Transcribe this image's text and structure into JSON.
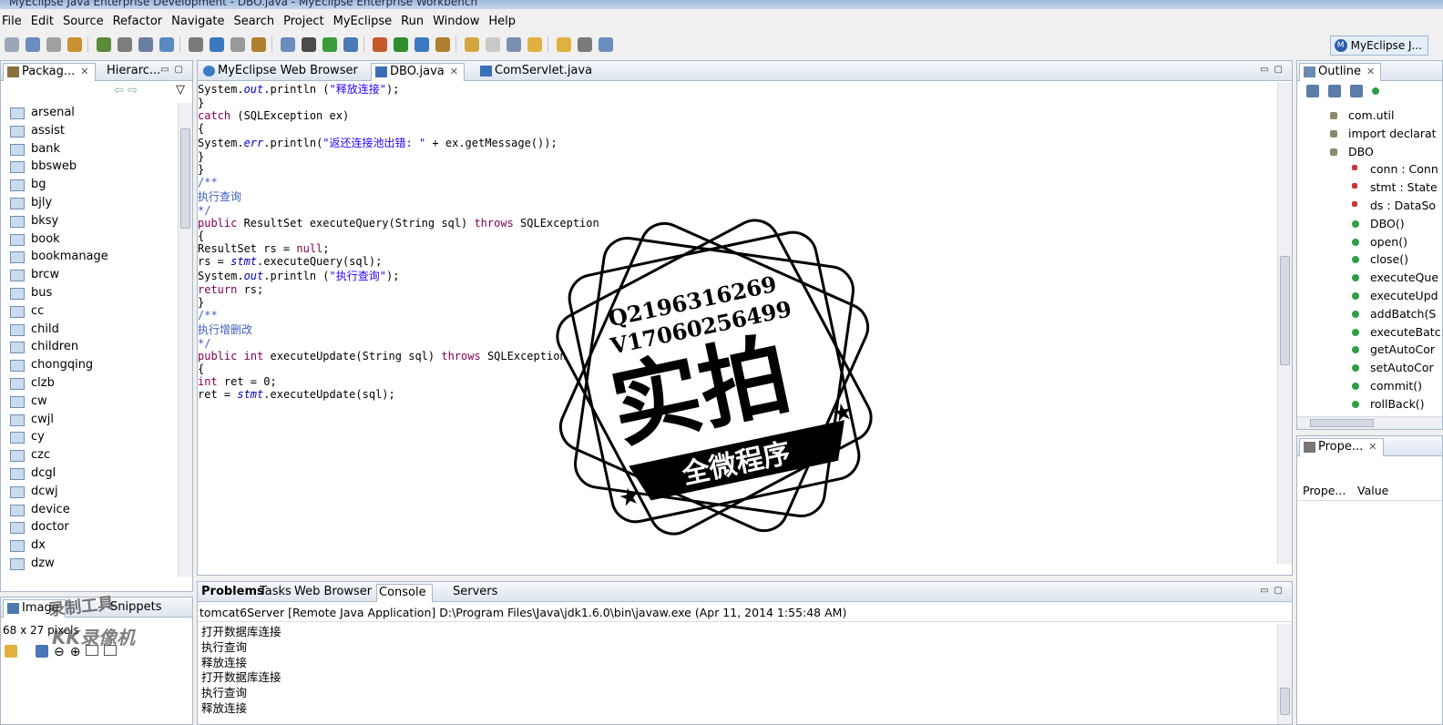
{
  "window": {
    "title": "MyEclipse Java Enterprise Development - DBO.java - MyEclipse Enterprise Workbench"
  },
  "menu": [
    "File",
    "Edit",
    "Source",
    "Refactor",
    "Navigate",
    "Search",
    "Project",
    "MyEclipse",
    "Run",
    "Window",
    "Help"
  ],
  "perspective": {
    "label": "MyEclipse J...",
    "icon": "myeclipse-icon"
  },
  "left_panel": {
    "tabs": [
      {
        "label": "Packag...",
        "icon": "package-icon"
      },
      {
        "label": "Hierarc...",
        "icon": "hierarchy-icon"
      }
    ],
    "items": [
      "arsenal",
      "assist",
      "bank",
      "bbsweb",
      "bg",
      "bjly",
      "bksy",
      "book",
      "bookmanage",
      "brcw",
      "bus",
      "cc",
      "child",
      "children",
      "chongqing",
      "clzb",
      "cw",
      "cwjl",
      "cy",
      "czc",
      "dcgl",
      "dcwj",
      "device",
      "doctor",
      "dx",
      "dzw"
    ]
  },
  "image_panel": {
    "tabs": [
      {
        "label": "Image",
        "icon": "image-icon"
      },
      {
        "label": "Snippets",
        "icon": "snippets-icon"
      }
    ],
    "size_text": "68 x 27 pixels",
    "watermark_top": "录制工具",
    "watermark_bottom": "KK录像机"
  },
  "editor": {
    "tabs": [
      {
        "label": "MyEclipse Web Browser",
        "icon": "globe-icon"
      },
      {
        "label": "DBO.java",
        "icon": "java-file-icon",
        "active": true
      },
      {
        "label": "ComServlet.java",
        "icon": "java-file-icon"
      }
    ],
    "lines": [
      {
        "indent": 8,
        "parts": [
          [
            "t",
            "System."
          ],
          [
            "f",
            "out"
          ],
          [
            "t",
            ".println ("
          ],
          [
            "s",
            "\"释放连接\""
          ],
          [
            "t",
            ");"
          ]
        ]
      },
      {
        "indent": 6,
        "parts": [
          [
            "t",
            "}"
          ]
        ]
      },
      {
        "indent": 6,
        "parts": [
          [
            "k",
            "catch"
          ],
          [
            "t",
            " (SQLException ex)"
          ]
        ]
      },
      {
        "indent": 6,
        "parts": [
          [
            "t",
            "{"
          ]
        ]
      },
      {
        "indent": 8,
        "parts": [
          [
            "t",
            "System."
          ],
          [
            "f",
            "err"
          ],
          [
            "t",
            ".println("
          ],
          [
            "s",
            "\"返还连接池出错: \""
          ],
          [
            "t",
            " + ex.getMessage());"
          ]
        ]
      },
      {
        "indent": 6,
        "parts": [
          [
            "t",
            "}"
          ]
        ]
      },
      {
        "indent": 4,
        "parts": [
          [
            "t",
            "}"
          ]
        ]
      },
      {
        "indent": 4,
        "parts": []
      },
      {
        "indent": 4,
        "parts": [
          [
            "c",
            "/**"
          ]
        ]
      },
      {
        "indent": 6,
        "parts": [
          [
            "c",
            "执行查询"
          ]
        ]
      },
      {
        "indent": 4,
        "parts": [
          [
            "c",
            "*/"
          ]
        ]
      },
      {
        "indent": 4,
        "parts": [
          [
            "k",
            "public"
          ],
          [
            "t",
            " ResultSet executeQuery(String sql) "
          ],
          [
            "k",
            "throws"
          ],
          [
            "t",
            " SQLException"
          ]
        ]
      },
      {
        "indent": 4,
        "parts": [
          [
            "t",
            "{"
          ]
        ]
      },
      {
        "indent": 6,
        "parts": [
          [
            "t",
            "ResultSet rs = "
          ],
          [
            "k",
            "null"
          ],
          [
            "t",
            ";"
          ]
        ]
      },
      {
        "indent": 4,
        "parts": []
      },
      {
        "indent": 4,
        "parts": []
      },
      {
        "indent": 6,
        "parts": [
          [
            "t",
            "rs = "
          ],
          [
            "f",
            "stmt"
          ],
          [
            "t",
            ".executeQuery(sql);"
          ]
        ]
      },
      {
        "indent": 6,
        "parts": [
          [
            "t",
            "System."
          ],
          [
            "f",
            "out"
          ],
          [
            "t",
            ".println ("
          ],
          [
            "s",
            "\"执行查询\""
          ],
          [
            "t",
            ");"
          ]
        ]
      },
      {
        "indent": 6,
        "parts": [
          [
            "k",
            "return"
          ],
          [
            "t",
            " rs;"
          ]
        ]
      },
      {
        "indent": 4,
        "parts": [
          [
            "t",
            "}"
          ]
        ]
      },
      {
        "indent": 4,
        "parts": []
      },
      {
        "indent": 4,
        "parts": [
          [
            "c",
            "/**"
          ]
        ]
      },
      {
        "indent": 6,
        "parts": [
          [
            "c",
            "执行增删改"
          ]
        ]
      },
      {
        "indent": 4,
        "parts": [
          [
            "c",
            "*/"
          ]
        ]
      },
      {
        "indent": 4,
        "parts": [
          [
            "k",
            "public"
          ],
          [
            "t",
            " "
          ],
          [
            "k",
            "int"
          ],
          [
            "t",
            " executeUpdate(String sql) "
          ],
          [
            "k",
            "throws"
          ],
          [
            "t",
            " SQLException"
          ]
        ]
      },
      {
        "indent": 4,
        "parts": [
          [
            "t",
            "{"
          ]
        ]
      },
      {
        "indent": 6,
        "parts": [
          [
            "k",
            "int"
          ],
          [
            "t",
            " ret = 0;"
          ]
        ]
      },
      {
        "indent": 4,
        "parts": []
      },
      {
        "indent": 4,
        "parts": []
      },
      {
        "indent": 6,
        "parts": [
          [
            "t",
            "ret = "
          ],
          [
            "f",
            "stmt"
          ],
          [
            "t",
            ".executeUpdate(sql);"
          ]
        ]
      }
    ]
  },
  "outline": {
    "tab": {
      "label": "Outline",
      "icon": "outline-icon"
    },
    "items": [
      {
        "label": "com.util",
        "kind": "package",
        "indent": 0
      },
      {
        "label": "import declarat",
        "kind": "imports",
        "indent": 0
      },
      {
        "label": "DBO",
        "kind": "class",
        "indent": 0
      },
      {
        "label": "conn : Conn",
        "kind": "field",
        "indent": 1
      },
      {
        "label": "stmt : State",
        "kind": "field",
        "indent": 1
      },
      {
        "label": "ds : DataSo",
        "kind": "field",
        "indent": 1
      },
      {
        "label": "DBO()",
        "kind": "method",
        "indent": 1
      },
      {
        "label": "open()",
        "kind": "method",
        "indent": 1
      },
      {
        "label": "close()",
        "kind": "method",
        "indent": 1
      },
      {
        "label": "executeQue",
        "kind": "method",
        "indent": 1
      },
      {
        "label": "executeUpd",
        "kind": "method",
        "indent": 1
      },
      {
        "label": "addBatch(S",
        "kind": "method",
        "indent": 1
      },
      {
        "label": "executeBatc",
        "kind": "method",
        "indent": 1
      },
      {
        "label": "getAutoCor",
        "kind": "method",
        "indent": 1
      },
      {
        "label": "setAutoCor",
        "kind": "method",
        "indent": 1
      },
      {
        "label": "commit()",
        "kind": "method",
        "indent": 1
      },
      {
        "label": "rollBack()",
        "kind": "method",
        "indent": 1
      }
    ]
  },
  "properties": {
    "tab": {
      "label": "Prope...",
      "icon": "properties-icon"
    },
    "columns": [
      "Prope...",
      "Value"
    ]
  },
  "console": {
    "tabs": [
      {
        "label": "Problems",
        "bold": true
      },
      {
        "label": "Tasks"
      },
      {
        "label": "Web Browser"
      },
      {
        "label": "Console",
        "active": true
      },
      {
        "label": "Servers"
      }
    ],
    "header": "tomcat6Server [Remote Java Application] D:\\Program Files\\Java\\jdk1.6.0\\bin\\javaw.exe (Apr 11, 2014 1:55:48 AM)",
    "lines": [
      "打开数据库连接",
      "执行查询",
      "释放连接",
      "打开数据库连接",
      "执行查询",
      "释放连接"
    ]
  },
  "stamp": {
    "contact1": "Q2196316269",
    "contact2": "V17060256499",
    "big_text": "实拍",
    "banner": "全微程序"
  },
  "colors": {
    "keyword": "#7f0055",
    "comment": "#3f5fbf",
    "string": "#2a00ff",
    "field": "#0000c0",
    "accent": "#2a5caa"
  }
}
